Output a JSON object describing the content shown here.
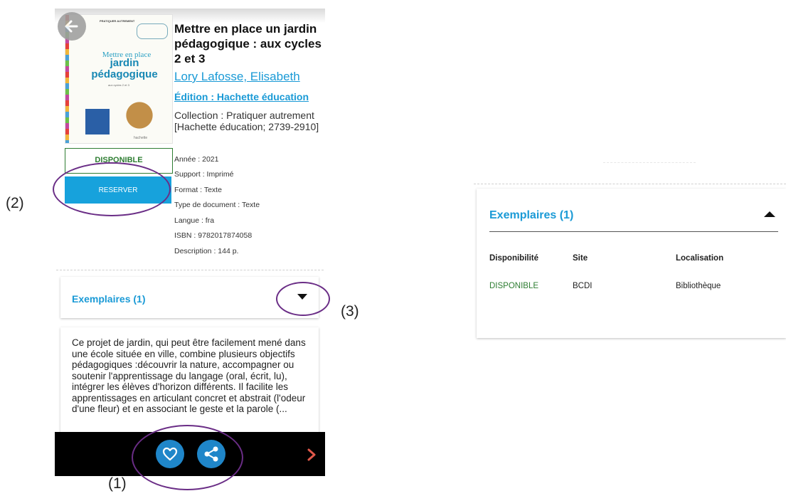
{
  "book": {
    "cover": {
      "series": "PRATIQUER AUTREMENT",
      "title_line1": "Mettre en place",
      "title_line2": "jardin",
      "title_line3": "pédagogique",
      "subtitle": "aux cycles 2 et 3",
      "publisher": "hachette"
    },
    "title": "Mettre en place un jardin pédagogique : aux cycles 2 et 3",
    "author": "Lory Lafosse, Elisabeth",
    "edition": "Édition : Hachette éducation",
    "collection": "Collection : Pratiquer autrement [Hachette éducation; 2739-2910]",
    "meta": {
      "annee": "Année : 2021",
      "support": "Support : Imprimé",
      "format": "Format : Texte",
      "type_doc": "Type de document : Texte",
      "langue": "Langue : fra",
      "isbn": "ISBN : 9782017874058",
      "description": "Description : 144 p."
    }
  },
  "status": {
    "label": "DISPONIBLE",
    "color": "#2e7d32"
  },
  "reserve_button": {
    "label": "RESERVER",
    "color": "#17a2dc"
  },
  "exemplaires": {
    "title": "Exemplaires (1)",
    "columns": [
      "Disponibilité",
      "Site",
      "Localisation"
    ],
    "rows": [
      {
        "disponibilite": "DISPONIBLE",
        "site": "BCDI",
        "localisation": "Bibliothèque"
      }
    ]
  },
  "summary": "Ce projet de jardin, qui peut être facilement mené dans une école située en ville, combine plusieurs objectifs pédagogiques :découvrir la nature, accompagner ou soutenir l'apprentissage du langage (oral, écrit, lu), intégrer les élèves d'horizon différents. Il facilite les apprentissages en articulant concret et abstrait (l'odeur d'une fleur) et en associant le geste et la parole (...",
  "bottom_bar": {
    "icons": [
      "heart-icon",
      "share-icon",
      "chevron-right-icon"
    ]
  },
  "annotations": {
    "a1": "(1)",
    "a2": "(2)",
    "a3": "(3)"
  },
  "colors": {
    "accent": "#1a9ad6",
    "annotation": "#6a2d86",
    "favorite": "#1f86c9",
    "next": "#e0584a"
  }
}
